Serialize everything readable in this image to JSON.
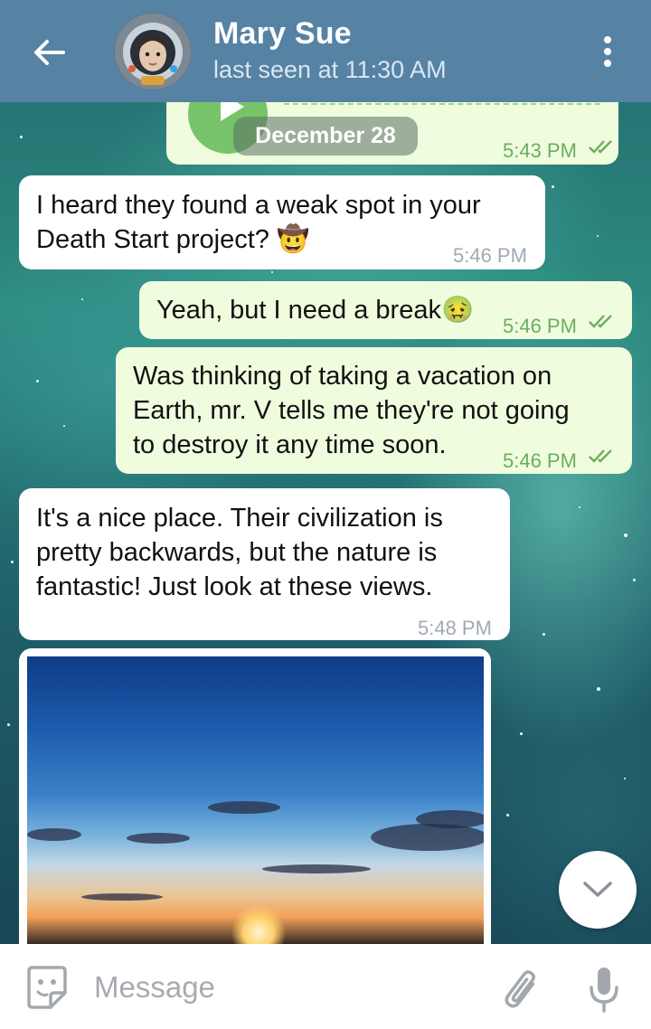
{
  "header": {
    "title": "Mary Sue",
    "subtitle": "last seen at 11:30 AM"
  },
  "date_separator": "December 28",
  "messages": [
    {
      "direction": "outgoing",
      "text": "",
      "time": "5:43 PM",
      "kind": "voice"
    },
    {
      "direction": "incoming",
      "text": "I heard they found a weak spot in your\nDeath Start project? 🤠",
      "time": "5:46 PM"
    },
    {
      "direction": "outgoing",
      "text": "Yeah, but I need a break🤢",
      "time": "5:46 PM"
    },
    {
      "direction": "outgoing",
      "text": "Was thinking of taking a vacation on\nEarth, mr. V tells me they're not going\nto destroy it any time soon.",
      "time": "5:46 PM"
    },
    {
      "direction": "incoming",
      "text": "It's a nice place. Their civilization is\npretty backwards, but the nature is\nfantastic! Just look at these views.",
      "time": "5:48 PM"
    },
    {
      "direction": "incoming",
      "kind": "photo"
    }
  ],
  "composer": {
    "placeholder": "Message"
  },
  "icons": {
    "back": "arrow-left-icon",
    "menu": "more-vertical-icon",
    "scroll": "chevron-down-icon",
    "sticker": "sticker-icon",
    "attach": "paperclip-icon",
    "mic": "microphone-icon"
  },
  "colors": {
    "header": "#5682a3",
    "incoming_bubble": "#ffffff",
    "outgoing_bubble": "#effdde",
    "outgoing_time": "#6cae5c"
  }
}
